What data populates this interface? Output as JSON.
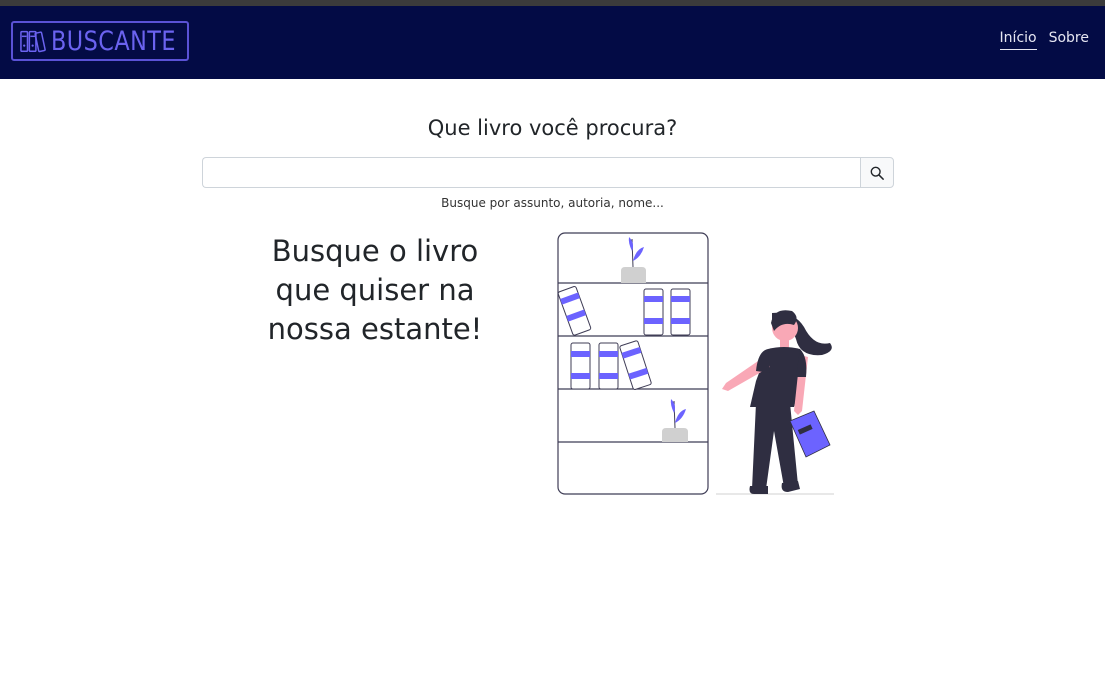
{
  "navbar": {
    "brand": "BUSCANTE",
    "links": [
      {
        "label": "Início",
        "active": true
      },
      {
        "label": "Sobre",
        "active": false
      }
    ]
  },
  "search": {
    "title": "Que livro você procura?",
    "value": "",
    "placeholder": "",
    "helper": "Busque por assunto, autoria, nome..."
  },
  "hero": {
    "text": "Busque o livro que quiser na nossa estante!"
  },
  "colors": {
    "navbar_bg": "#030b45",
    "brand": "#6b63f0",
    "accent": "#6c63ff"
  },
  "icons": {
    "logo": "books-icon",
    "search": "search-icon"
  }
}
